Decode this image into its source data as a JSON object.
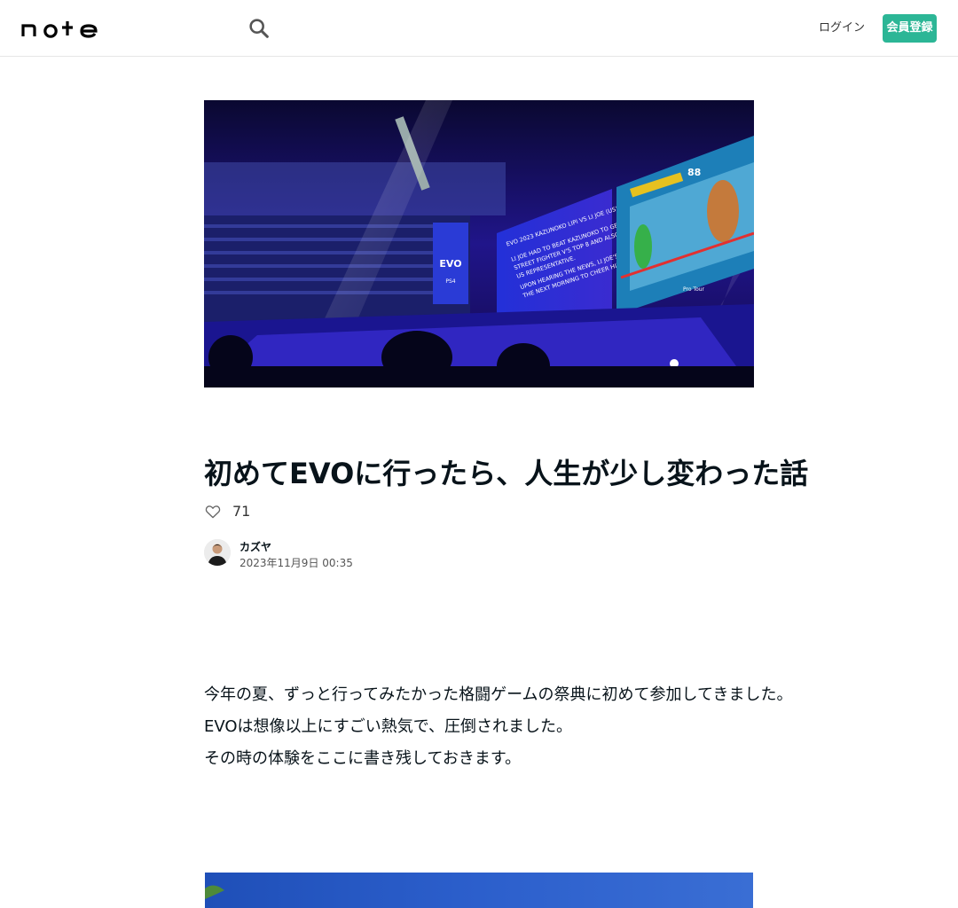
{
  "header": {
    "logo_text": "note",
    "login_label": "ログイン",
    "signup_label": "会員登録",
    "brand_color": "#2cb696"
  },
  "hero": {
    "screen_caption_lines": [
      "EVO 2023 KAZUNOKO LIPI VS LI JOE (US)",
      "LI JOE HAD TO BEAT KAZUNOKO TO GET INTO",
      "STREET FIGHTER V'S TOP 8 AND ALSO BE THE LONE",
      "US REPRESENTATIVE.",
      "UPON HEARING THE NEWS, LI JOE'S DAD FLEW OUT",
      "THE NEXT MORNING TO CHEER HIM ON IN PERSON!"
    ],
    "banner_logo": "EVO",
    "banner_sub": "PS4",
    "hud_timer": "88",
    "stage_text": "Pro Tour"
  },
  "article": {
    "title": "初めてEVOに行ったら、人生が少し変わった話",
    "like_count": "71",
    "author_name": "カズヤ",
    "date": "2023年11月9日 00:35",
    "paragraphs": [
      "今年の夏、ずっと行ってみたかった格闘ゲームの祭典に初めて参加してきました。",
      "EVOは想像以上にすごい熱気で、圧倒されました。",
      "その時の体験をここに書き残しておきます。"
    ]
  },
  "icons": {
    "search": "search-icon",
    "like": "heart-icon"
  }
}
